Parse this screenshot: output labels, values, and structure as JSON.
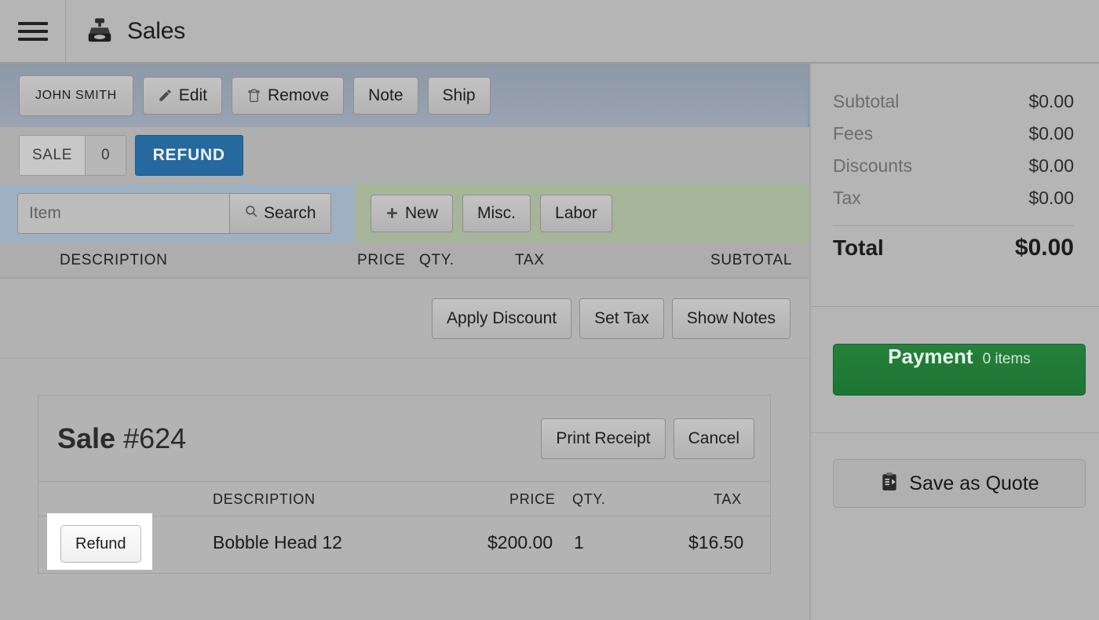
{
  "header": {
    "title": "Sales",
    "menu_icon": "hamburger-menu-icon",
    "app_icon": "cash-register-icon"
  },
  "toolbar": {
    "customer": "JOHN SMITH",
    "edit": "Edit",
    "remove": "Remove",
    "note": "Note",
    "ship": "Ship"
  },
  "tabs": {
    "sale_label": "SALE",
    "sale_count": "0",
    "refund_label": "REFUND"
  },
  "search": {
    "placeholder": "Item",
    "search_button": "Search",
    "new_button": "New",
    "misc_button": "Misc.",
    "labor_button": "Labor"
  },
  "line_items_header": {
    "description": "DESCRIPTION",
    "price": "PRICE",
    "qty": "QTY.",
    "tax": "TAX",
    "subtotal": "SUBTOTAL"
  },
  "mid_actions": {
    "apply_discount": "Apply Discount",
    "set_tax": "Set Tax",
    "show_notes": "Show Notes"
  },
  "sale_card": {
    "title_bold": "Sale",
    "title_number": "#624",
    "print_receipt": "Print Receipt",
    "cancel": "Cancel",
    "columns": {
      "description": "DESCRIPTION",
      "price": "PRICE",
      "qty": "QTY.",
      "tax": "TAX"
    },
    "rows": [
      {
        "action": "Refund",
        "description": "Bobble Head 12",
        "price": "$200.00",
        "qty": "1",
        "tax": "$16.50"
      }
    ]
  },
  "totals": {
    "lines": [
      {
        "label": "Subtotal",
        "value": "$0.00"
      },
      {
        "label": "Fees",
        "value": "$0.00"
      },
      {
        "label": "Discounts",
        "value": "$0.00"
      },
      {
        "label": "Tax",
        "value": "$0.00"
      }
    ],
    "grand_label": "Total",
    "grand_value": "$0.00"
  },
  "payment": {
    "label": "Payment",
    "items": "0 items"
  },
  "quote": {
    "label": "Save as Quote",
    "icon": "clipboard-save-icon"
  },
  "colors": {
    "accent_blue": "#25699e",
    "payment_green": "#1d7533",
    "toolbar_blue_gray": "#99a3b1",
    "actions_green": "#a6b49a",
    "page_gray": "#b3b3b3"
  }
}
